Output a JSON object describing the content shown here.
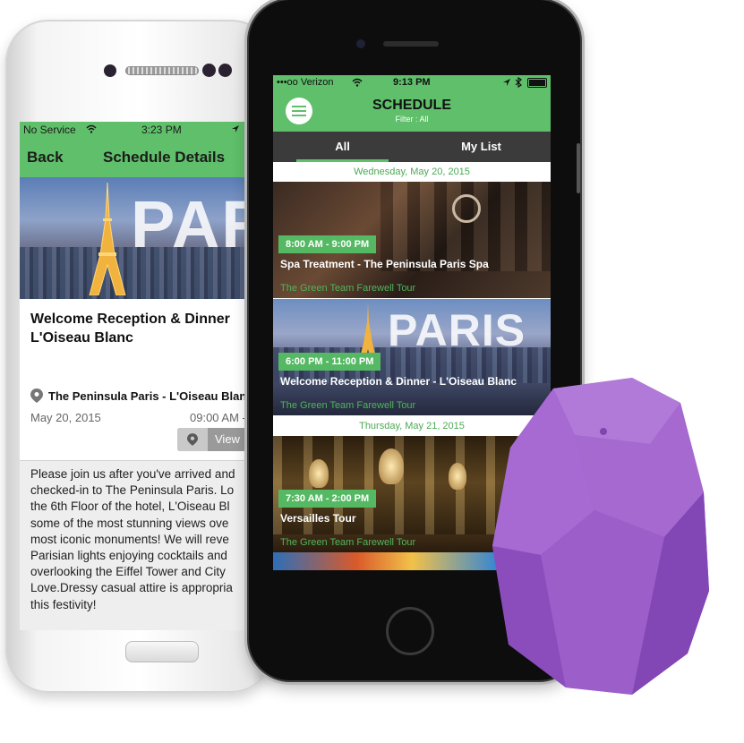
{
  "back_phone": {
    "status": {
      "carrier": "No Service",
      "time": "3:23 PM"
    },
    "nav": {
      "back_label": "Back",
      "title": "Schedule Details"
    },
    "banner_text": "PARIS",
    "event": {
      "title_line1": "Welcome Reception & Dinner",
      "title_line2": "L'Oiseau Blanc",
      "location": "The Peninsula Paris - L'Oiseau Blan",
      "date": "May 20, 2015",
      "time": "09:00 AM -",
      "view_label": "View"
    },
    "description_lines": [
      "Please join us after you've arrived and",
      "checked-in to The Peninsula Paris. Lo",
      "the 6th Floor of the hotel, L'Oiseau Bl",
      "some of the most stunning views ove",
      "most iconic monuments! We will reve",
      "Parisian lights enjoying cocktails and",
      "overlooking the Eiffel Tower and City",
      "Love.Dressy casual attire is appropria",
      "this festivity!"
    ]
  },
  "front_phone": {
    "status": {
      "carrier": "•••oo Verizon",
      "time": "9:13 PM"
    },
    "header": {
      "title": "SCHEDULE",
      "subtitle": "Filter : All"
    },
    "tabs": [
      {
        "label": "All"
      },
      {
        "label": "My List"
      }
    ],
    "days": [
      {
        "label": "Wednesday, May 20, 2015"
      },
      {
        "label": "Thursday, May 21, 2015"
      }
    ],
    "events": [
      {
        "time": "8:00 AM - 9:00 PM",
        "title": "Spa Treatment - The Peninsula Paris Spa",
        "subtitle": "The Green Team Farewell Tour"
      },
      {
        "time": "6:00 PM - 11:00 PM",
        "title": "Welcome Reception & Dinner - L'Oiseau Blanc",
        "subtitle": "The Green Team Farewell Tour",
        "banner_text": "PARIS"
      },
      {
        "time": "7:30 AM - 2:00 PM",
        "title": "Versailles Tour",
        "subtitle": "The Green Team Farewell Tour"
      }
    ]
  },
  "colors": {
    "accent_green": "#5fbf6a",
    "dark_bar": "#3b3b3b",
    "beacon_purple": "#9a5fc6"
  }
}
